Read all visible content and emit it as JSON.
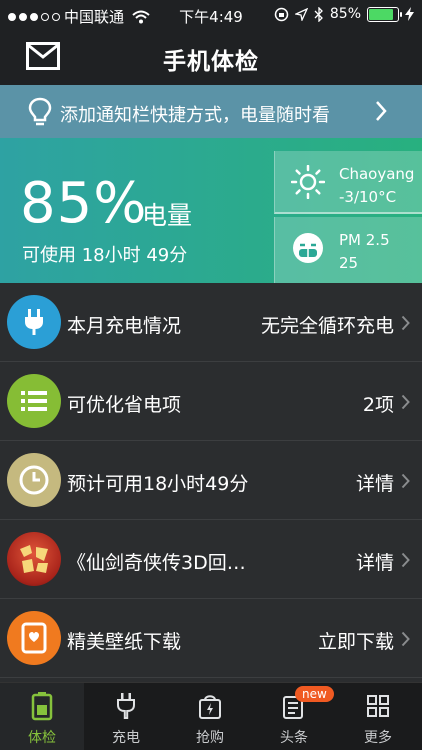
{
  "status_bar": {
    "carrier": "中国联通",
    "time": "下午4:49",
    "battery_percent": "85%",
    "battery_level": 0.85
  },
  "nav": {
    "title": "手机体检"
  },
  "tip": {
    "text": "添加通知栏快捷方式，电量随时看"
  },
  "battery_panel": {
    "percent": "85%",
    "unit": "电量",
    "remaining": "可使用 18小时 49分"
  },
  "weather": {
    "location": "Chaoyang",
    "temperature": "-3/10°C"
  },
  "air": {
    "label": "PM 2.5",
    "value": "25"
  },
  "list": [
    {
      "label": "本月充电情况",
      "value": "无完全循环充电",
      "icon": "plug-icon",
      "color": "#2b9fd6"
    },
    {
      "label": "可优化省电项",
      "value": "2项",
      "icon": "list-icon",
      "color": "#86bd35"
    },
    {
      "label": "预计可用18小时49分",
      "value": "详情",
      "icon": "clock-icon",
      "color": "#c5b97f"
    },
    {
      "label": "《仙剑奇侠传3D回…",
      "value": "详情",
      "icon": "game-icon",
      "color": "#c0392b"
    },
    {
      "label": "精美壁纸下载",
      "value": "立即下载",
      "icon": "wallpaper-icon",
      "color": "#f07a1f"
    }
  ],
  "tabs": [
    {
      "label": "体检",
      "icon": "battery-icon",
      "active": true
    },
    {
      "label": "充电",
      "icon": "plug-icon",
      "active": false
    },
    {
      "label": "抢购",
      "icon": "bag-icon",
      "active": false
    },
    {
      "label": "头条",
      "icon": "news-icon",
      "active": false,
      "badge": "new"
    },
    {
      "label": "更多",
      "icon": "grid-icon",
      "active": false
    }
  ],
  "colors": {
    "accent_green": "#86c23c",
    "panel_start": "#2ea2a3",
    "panel_end": "#28b07f",
    "tip_bar": "#5b93a7"
  }
}
